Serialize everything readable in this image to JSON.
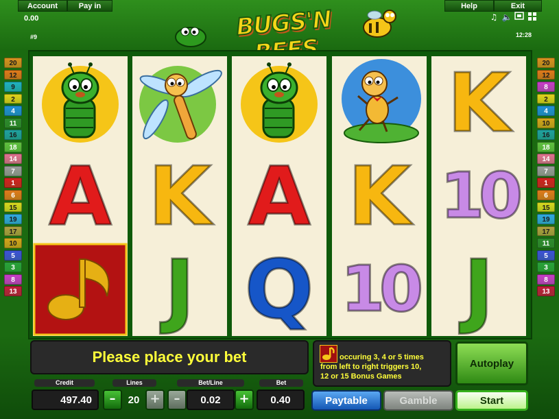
{
  "topbar": {
    "account_label": "Account",
    "payin_label": "Pay in",
    "help_label": "Help",
    "exit_label": "Exit",
    "credit_display": "0.00",
    "game_number": "#9",
    "clock": "12:28",
    "icons": [
      "music-icon",
      "sound-icon",
      "display-icon",
      "fullscreen-icon"
    ]
  },
  "logo": {
    "text": "BUGS'N BEES"
  },
  "lines_left": [
    "20",
    "12",
    "9",
    "2",
    "4",
    "11",
    "16",
    "18",
    "14",
    "7",
    "1",
    "6",
    "15",
    "19",
    "17",
    "10",
    "5",
    "3",
    "8",
    "13"
  ],
  "lines_right": [
    "20",
    "12",
    "8",
    "2",
    "4",
    "10",
    "16",
    "18",
    "14",
    "7",
    "1",
    "6",
    "15",
    "19",
    "17",
    "11",
    "5",
    "3",
    "8",
    "13"
  ],
  "line_colors": {
    "1": "#d42020",
    "2": "#e0d21c",
    "3": "#2aa23a",
    "4": "#1f8fd8",
    "5": "#3d52d8",
    "6": "#e07a1c",
    "7": "#9a9a9a",
    "8": "#c83cc8",
    "9": "#20b0c0",
    "10": "#d4a41c",
    "11": "#2e8a2e",
    "12": "#e0781c",
    "13": "#c01c3c",
    "14": "#e07090",
    "15": "#d8d820",
    "16": "#20a0a0",
    "17": "#b0a040",
    "18": "#60c040",
    "19": "#30a8e0",
    "20": "#d89020"
  },
  "reels": [
    [
      "caterpillar",
      "A",
      "note"
    ],
    [
      "dragonfly",
      "K",
      "J"
    ],
    [
      "caterpillar",
      "A",
      "Q"
    ],
    [
      "ant",
      "K",
      "10"
    ],
    [
      "K",
      "10",
      "J"
    ]
  ],
  "symbol_colors": {
    "A": "#e11b1b",
    "K": "#f7b710",
    "Q": "#1656c8",
    "J": "#3fa51c",
    "10": "#c88ae6"
  },
  "message": "Please place your bet",
  "info": {
    "line1": "occuring 3, 4 or 5 times",
    "line2": "from left to right triggers 10,",
    "line3": "12 or 15 Bonus Games"
  },
  "labels": {
    "credit": "Credit",
    "lines": "Lines",
    "betline": "Bet/Line",
    "bet": "Bet"
  },
  "values": {
    "credit": "497.40",
    "lines": "20",
    "betline": "0.02",
    "bet": "0.40"
  },
  "controls": {
    "minus": "–",
    "plus": "+"
  },
  "buttons": {
    "autoplay": "Autoplay",
    "paytable": "Paytable",
    "gamble": "Gamble",
    "start": "Start"
  }
}
